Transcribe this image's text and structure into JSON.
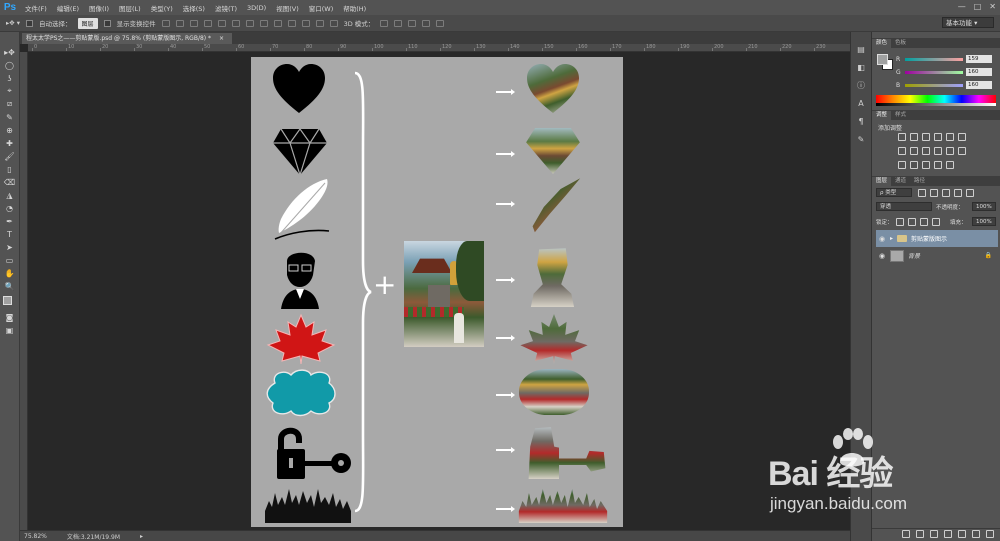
{
  "app": {
    "logo": "Ps",
    "window_controls": [
      "—",
      "□",
      "✕"
    ]
  },
  "menu": [
    "文件(F)",
    "编辑(E)",
    "图像(I)",
    "图层(L)",
    "类型(Y)",
    "选择(S)",
    "滤镜(T)",
    "3D(D)",
    "视图(V)",
    "窗口(W)",
    "帮助(H)"
  ],
  "options_bar": {
    "auto_select_label": "自动选择：",
    "auto_select_value": "图层",
    "show_transform_label": "显示变换控件",
    "mode_3d_label": "3D 模式：",
    "workspace": "基本功能"
  },
  "document": {
    "tab_title": "程太太学PS之——剪贴蒙版.psd @ 75.8% (剪贴蒙版图示, RGB/8) *",
    "tab_close": "×",
    "ruler_numbers": [
      "0",
      "10",
      "20",
      "30",
      "40",
      "50",
      "60",
      "70",
      "80",
      "90",
      "100",
      "110",
      "120",
      "130",
      "140",
      "150",
      "160",
      "170",
      "180",
      "190",
      "200",
      "210",
      "220",
      "230"
    ]
  },
  "status": {
    "zoom": "75.82%",
    "doc_size": "文档:3.21M/19.9M",
    "arrow": "▸"
  },
  "tools": [
    "▸✥",
    "◯",
    "ʖ",
    "⌖",
    "⧄",
    "✎",
    "⊕",
    "✚",
    "🖌",
    "▯",
    "⌫",
    "◮",
    "◔",
    "✒",
    "T",
    "➤",
    "▭",
    "✋",
    "🔍"
  ],
  "color_panel": {
    "tabs": [
      "颜色",
      "色板"
    ],
    "r_label": "R",
    "g_label": "G",
    "b_label": "B",
    "r": "159",
    "g": "160",
    "b": "160"
  },
  "adjustments_panel": {
    "tabs": [
      "调整",
      "样式"
    ],
    "title": "添加调整"
  },
  "layers_panel": {
    "tabs": [
      "图层",
      "通道",
      "路径"
    ],
    "kind_filter": "ρ 类型",
    "blend_mode": "穿透",
    "opacity_label": "不透明度：",
    "opacity": "100%",
    "lock_label": "锁定：",
    "fill_label": "填充：",
    "fill": "100%",
    "layers": [
      {
        "name": "剪贴蒙版图示",
        "type": "group",
        "selected": true
      },
      {
        "name": "背景",
        "type": "background",
        "selected": false
      }
    ]
  },
  "canvas": {
    "artboard_color": "#a9a9a9",
    "plus_sign": "+",
    "shapes": [
      "heart",
      "diamond",
      "feather",
      "man-portrait",
      "maple-leaf",
      "cloud-label",
      "lock-key",
      "crowd-silhouette"
    ],
    "results": [
      "heart",
      "diamond",
      "feather",
      "man-portrait",
      "maple-leaf",
      "cloud-label",
      "lock-key",
      "crowd-silhouette"
    ]
  },
  "watermark": {
    "logo_text": "Bai 经验",
    "url": "jingyan.baidu.com"
  }
}
